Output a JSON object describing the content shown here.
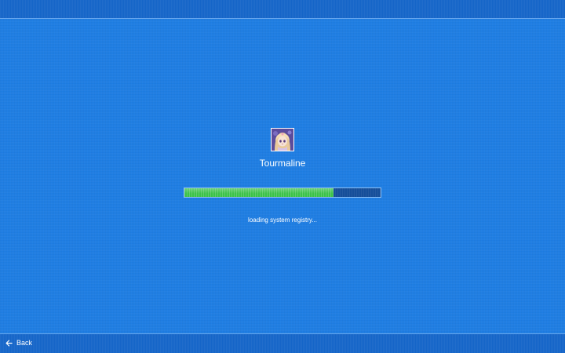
{
  "user": {
    "name": "Tourmaline",
    "avatar_icon": "anime-character-avatar"
  },
  "loading": {
    "progress_percent": 76,
    "status": "loading system registry...",
    "fill_color": "#3cc24a"
  },
  "footer": {
    "back_label": "Back",
    "back_icon": "arrow-left-icon"
  },
  "colors": {
    "background": "#1e7ee4",
    "bar": "#1565c8"
  }
}
